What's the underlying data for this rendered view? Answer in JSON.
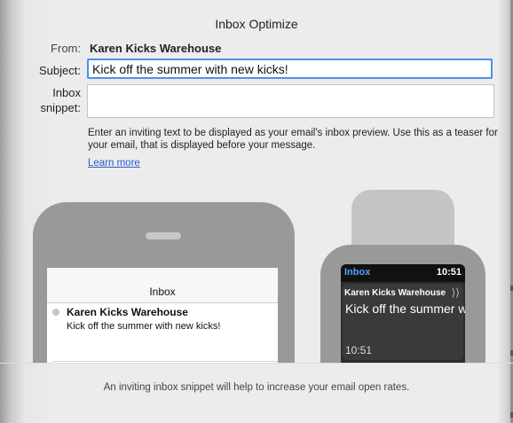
{
  "window": {
    "title": "Inbox Optimize"
  },
  "form": {
    "from_label": "From:",
    "from_value": "Karen Kicks Warehouse",
    "subject_label": "Subject:",
    "subject_value": "Kick off the summer with new kicks!",
    "snippet_label_line1": "Inbox",
    "snippet_label_line2": "snippet:",
    "snippet_value": "",
    "help_text": "Enter an inviting text to be displayed as your email's inbox preview. Use this as a teaser for your email, that is displayed before your message.",
    "learn_more": "Learn more"
  },
  "phone_preview": {
    "nav_title": "Inbox",
    "sender": "Karen Kicks Warehouse",
    "subject": "Kick off the summer with new kicks!"
  },
  "watch_preview": {
    "inbox_label": "Inbox",
    "time_top": "10:51",
    "sender": "Karen Kicks Warehouse",
    "chevron_icon": "double-chevron-right-icon",
    "subject": "Kick off the summer w",
    "time_bottom": "10:51"
  },
  "footer": {
    "text": "An inviting inbox snippet will help to increase your email open rates."
  },
  "colors": {
    "accent": "#4d90f0",
    "link": "#2a5ccf",
    "watch_inbox": "#4fa3ff",
    "device_gray": "#999999"
  }
}
